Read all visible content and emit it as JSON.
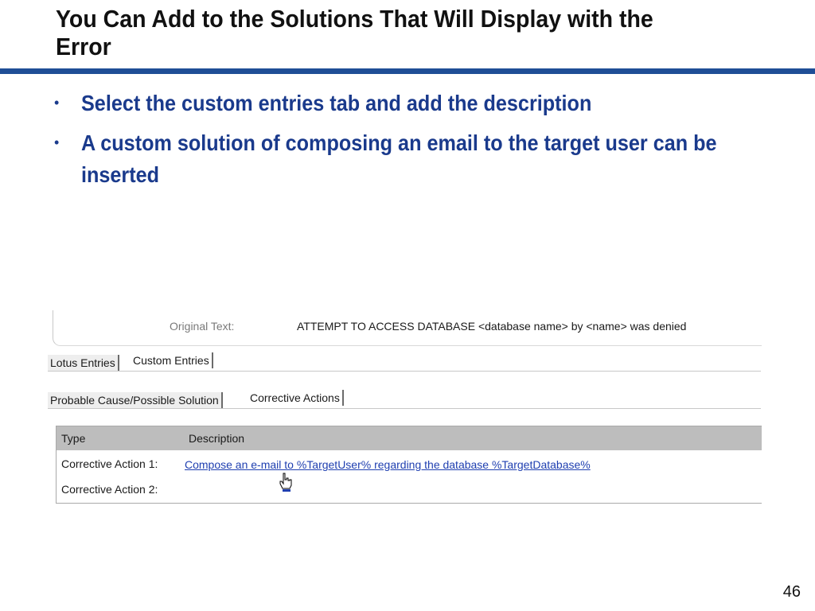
{
  "slide": {
    "title": "You Can Add to the Solutions That Will Display with the Error",
    "bullets": [
      "Select the custom entries tab and add the description",
      "A custom solution of composing an email to the target user can be inserted"
    ],
    "page_number": "46"
  },
  "screenshot": {
    "original_text_label": "Original Text:",
    "original_text_value": "ATTEMPT TO ACCESS DATABASE <database name> by <name> was denied",
    "tabs_top": [
      "Lotus Entries",
      "Custom Entries"
    ],
    "tabs_bottom": [
      "Probable Cause/Possible Solution",
      "Corrective Actions"
    ],
    "grid": {
      "headers": [
        "Type",
        "Description"
      ],
      "rows": [
        {
          "type": "Corrective Action 1:",
          "description": "Compose an e-mail to %TargetUser% regarding the database %TargetDatabase%"
        },
        {
          "type": "Corrective Action 2:",
          "description": ""
        }
      ]
    },
    "cursor_icon": "hand-pointer-icon"
  },
  "colors": {
    "title_rule": "#1f4e96",
    "bullet_text": "#1a3a8c",
    "link": "#1f3fb0",
    "grid_header": "#bdbdbd"
  }
}
